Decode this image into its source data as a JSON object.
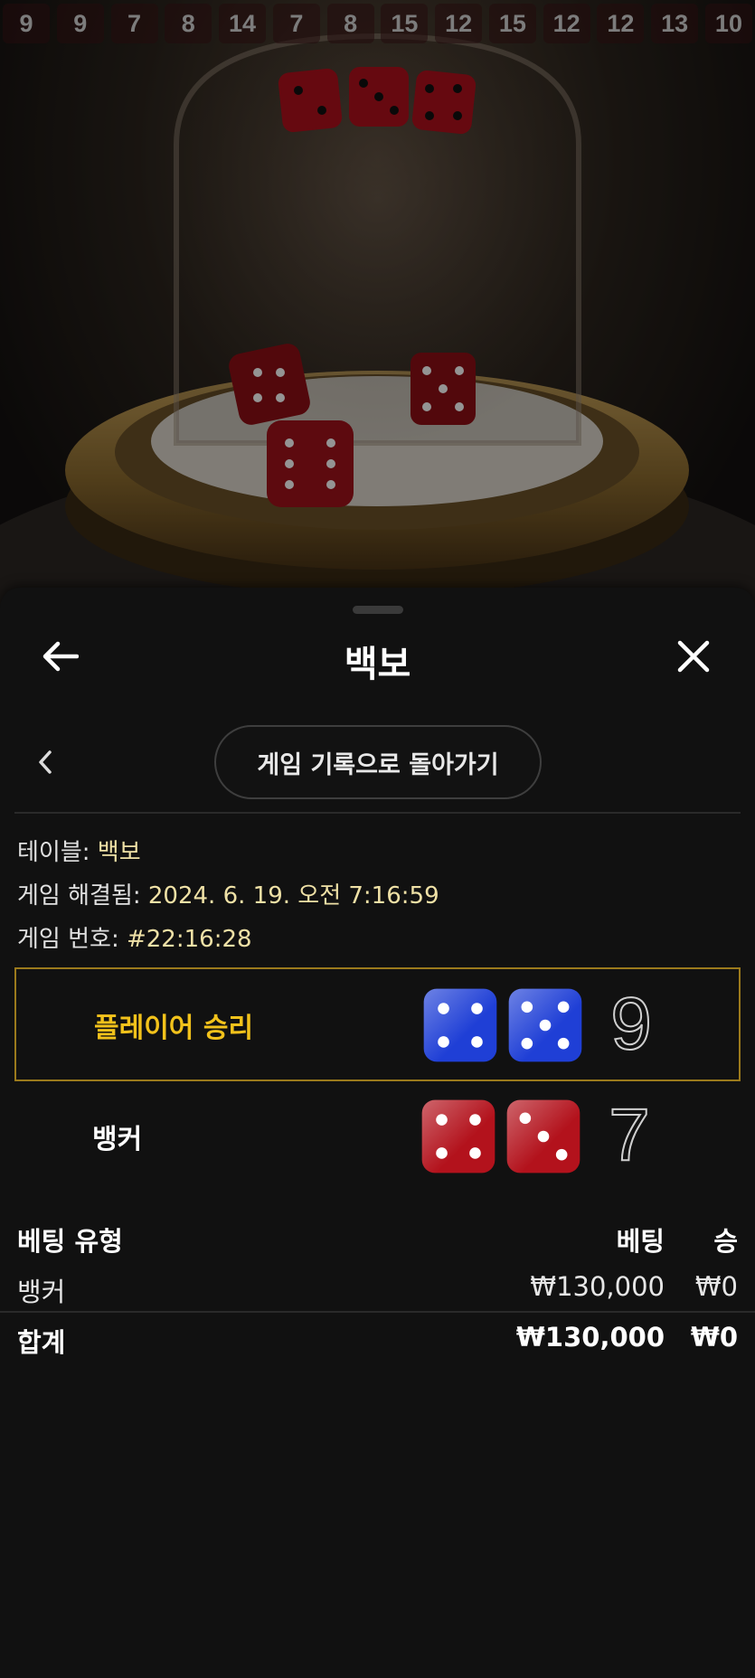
{
  "road": [
    "9",
    "9",
    "7",
    "8",
    "14",
    "7",
    "8",
    "15",
    "12",
    "15",
    "12",
    "12",
    "13",
    "10"
  ],
  "sheet": {
    "title": "백보",
    "history_button": "게임 기록으로 돌아가기",
    "table_label": "테이블: ",
    "table_value": "백보",
    "resolved_label": "게임 해결됨: ",
    "resolved_value": "2024. 6. 19. 오전 7:16:59",
    "game_id_label": "게임 번호: ",
    "game_id_value": "#22:16:28"
  },
  "results": {
    "player": {
      "label": "플레이어 승리",
      "dice": [
        4,
        5
      ],
      "score": "9",
      "color": "#1f3fd6"
    },
    "banker": {
      "label": "뱅커",
      "dice": [
        4,
        3
      ],
      "score": "7",
      "color": "#b3121c"
    }
  },
  "bets": {
    "headers": {
      "type": "베팅 유형",
      "bet": "베팅",
      "win": "승"
    },
    "rows": [
      {
        "type": "뱅커",
        "bet": "₩130,000",
        "win": "₩0"
      }
    ],
    "total": {
      "type": "합계",
      "bet": "₩130,000",
      "win": "₩0"
    }
  },
  "colors": {
    "accent_gold": "#f2c21b",
    "winner_border": "#9b7a1c",
    "detail_text": "#efe1a6"
  },
  "icons": {
    "back": "arrow-left-icon",
    "close": "close-icon",
    "prev": "chevron-left-icon"
  }
}
